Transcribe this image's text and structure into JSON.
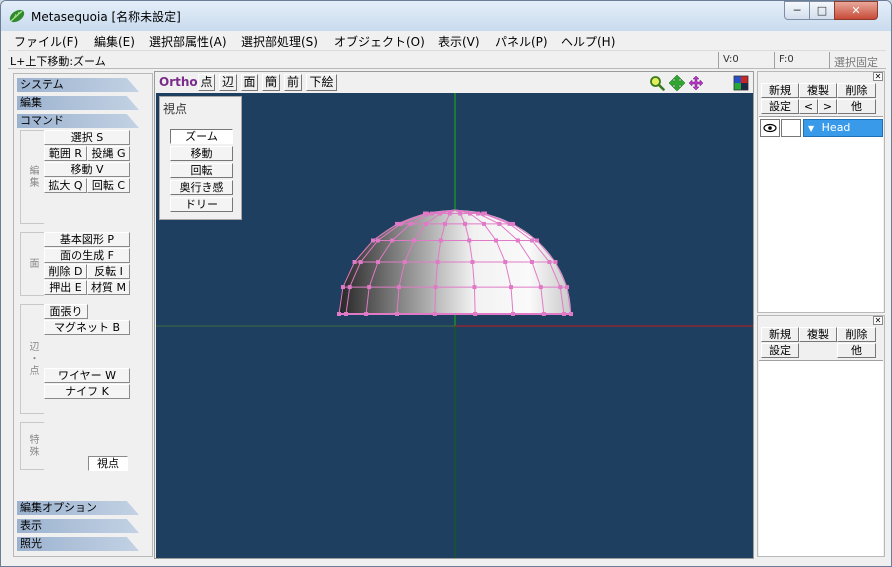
{
  "window": {
    "title": "Metasequoia [名称未設定]",
    "controls": {
      "minimize": "─",
      "maximize": "□",
      "close": "✕"
    }
  },
  "menu": [
    "ファイル(F)",
    "編集(E)",
    "選択部属性(A)",
    "選択部処理(S)",
    "オブジェクト(O)",
    "表示(V)",
    "パネル(P)",
    "ヘルプ(H)"
  ],
  "status": {
    "hint": "L+上下移動:ズーム",
    "vertex_count": "V:0",
    "face_count": "F:0",
    "selection_lock": "選択固定"
  },
  "left_panel": {
    "headers": {
      "system": "システム",
      "edit": "編集",
      "command": "コマンド",
      "edit_options": "編集オプション",
      "display": "表示",
      "lighting": "照光"
    },
    "group_labels": {
      "edit": "編集",
      "face": "面",
      "edge_vertex": "辺・点",
      "special": "特殊"
    },
    "buttons": {
      "select": "選択 S",
      "range": "範囲 R",
      "lasso": "投縄 G",
      "move": "移動 V",
      "scale": "拡大 Q",
      "rotate": "回転 C",
      "primitive": "基本図形 P",
      "create_face": "面の生成 F",
      "delete": "削除 D",
      "invert": "反転 I",
      "extrude": "押出 E",
      "material": "材質 M",
      "stretch_face": "面張り",
      "magnet": "マグネット B",
      "wire": "ワイヤー W",
      "knife": "ナイフ K",
      "viewpoint": "視点"
    }
  },
  "view": {
    "mode_label": "Ortho",
    "toolbar": [
      "点",
      "辺",
      "面",
      "簡",
      "前",
      "下絵"
    ],
    "tool_icons": [
      "zoom-icon",
      "move-view-icon",
      "rotate-view-icon",
      "color-palette-icon"
    ],
    "viewpoint_panel": {
      "title": "視点",
      "buttons": [
        "ズーム",
        "移動",
        "回転",
        "奥行き感",
        "ドリー"
      ],
      "active_index": 0
    }
  },
  "object_panel": {
    "buttons": {
      "new": "新規",
      "copy": "複製",
      "delete": "削除",
      "settings": "設定",
      "prev": "<",
      "next": ">",
      "other": "他"
    },
    "objects": [
      {
        "name": "Head",
        "visible": true,
        "selected": true
      }
    ]
  },
  "material_panel": {
    "buttons": {
      "new": "新規",
      "copy": "複製",
      "delete": "削除",
      "settings": "設定",
      "other": "他"
    }
  },
  "colors": {
    "viewport_bg": "#1e3f5f",
    "wireframe": "#e07ac6",
    "axis_y": "#12b812",
    "axis_x": "#c21b1b",
    "selection": "#3a9aea"
  }
}
